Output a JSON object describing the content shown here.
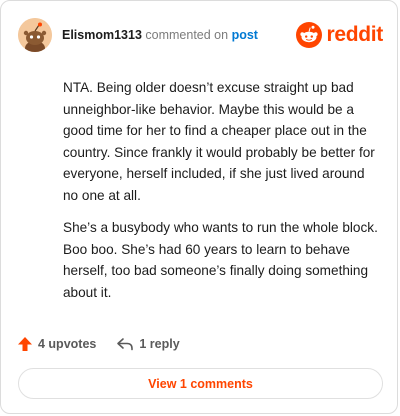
{
  "header": {
    "username": "Elismom1313",
    "action_text": "commented on",
    "post_link": "post",
    "brand": "reddit"
  },
  "comment": {
    "paragraphs": [
      "NTA. Being older doesn’t excuse straight up bad unneighbor-like behavior. Maybe this would be a good time for her to find a cheaper place out in the country. Since frankly it would probably be better for everyone, herself included, if she just lived around no one at all.",
      "She’s a busybody who wants to run the whole block. Boo boo. She’s had 60 years to learn to behave herself, too bad someone’s finally doing something about it."
    ]
  },
  "footer": {
    "upvotes": "4 upvotes",
    "replies": "1 reply",
    "view_comments": "View 1 comments"
  },
  "colors": {
    "accent": "#ff4500",
    "link": "#0079d3"
  },
  "icons": {
    "avatar": "snoo-avatar",
    "brand": "reddit-logo-icon",
    "upvote": "upvote-arrow-icon",
    "reply": "reply-arrow-icon"
  }
}
